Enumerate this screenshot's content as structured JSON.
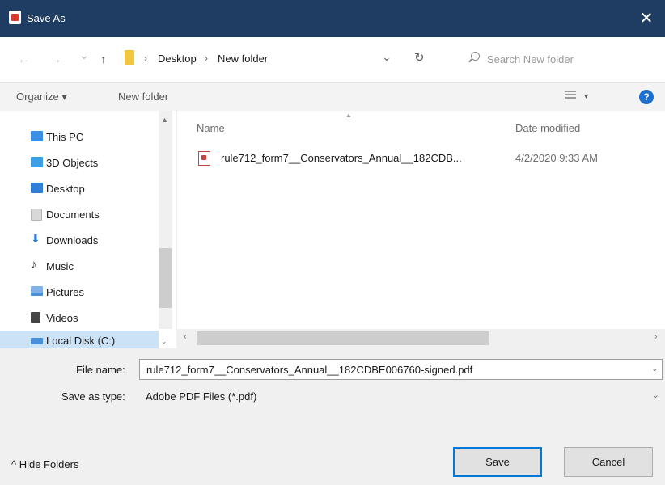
{
  "window": {
    "title": "Save As",
    "close_label": "✕"
  },
  "address": {
    "back": "←",
    "forward": "→",
    "recent": "⌄",
    "up": "↑",
    "crumbs": [
      "Desktop",
      "New folder"
    ],
    "crumb_separator": "›",
    "leading_separator": "›",
    "dropdown": "⌄",
    "refresh": "↻",
    "search_placeholder": "Search New folder"
  },
  "toolbar": {
    "organize": "Organize ▾",
    "new_folder": "New folder",
    "view_dropdown": "▾",
    "help": "?"
  },
  "navpane": {
    "items": [
      {
        "label": "This PC",
        "icon": "computer-icon",
        "color": "#3a8ee6"
      },
      {
        "label": "3D Objects",
        "icon": "cube-icon",
        "color": "#3ba0e6"
      },
      {
        "label": "Desktop",
        "icon": "desktop-icon",
        "color": "#2f7fd8"
      },
      {
        "label": "Documents",
        "icon": "documents-icon",
        "color": "#c8c8c8"
      },
      {
        "label": "Downloads",
        "icon": "download-icon",
        "color": "#2f7fd8"
      },
      {
        "label": "Music",
        "icon": "music-icon",
        "color": "#333333"
      },
      {
        "label": "Pictures",
        "icon": "pictures-icon",
        "color": "#4a90d9"
      },
      {
        "label": "Videos",
        "icon": "videos-icon",
        "color": "#444444"
      },
      {
        "label": "Local Disk (C:)",
        "icon": "disk-icon",
        "color": "#4a90d9"
      }
    ]
  },
  "filelist": {
    "columns": {
      "name": "Name",
      "date": "Date modified"
    },
    "files": [
      {
        "name": "rule712_form7__Conservators_Annual__182CDB...",
        "date": "4/2/2020 9:33 AM"
      }
    ]
  },
  "form": {
    "file_name_label": "File name:",
    "file_name_value": "rule712_form7__Conservators_Annual__182CDBE006760-signed.pdf",
    "save_type_label": "Save as type:",
    "save_type_value": "Adobe PDF Files (*.pdf)",
    "dropdown": "⌄"
  },
  "footer": {
    "hide_folders": "^ Hide Folders",
    "save": "Save",
    "cancel": "Cancel"
  },
  "colors": {
    "titlebar": "#1f3d63",
    "selection": "#cce2f7",
    "accent": "#0078d7"
  }
}
